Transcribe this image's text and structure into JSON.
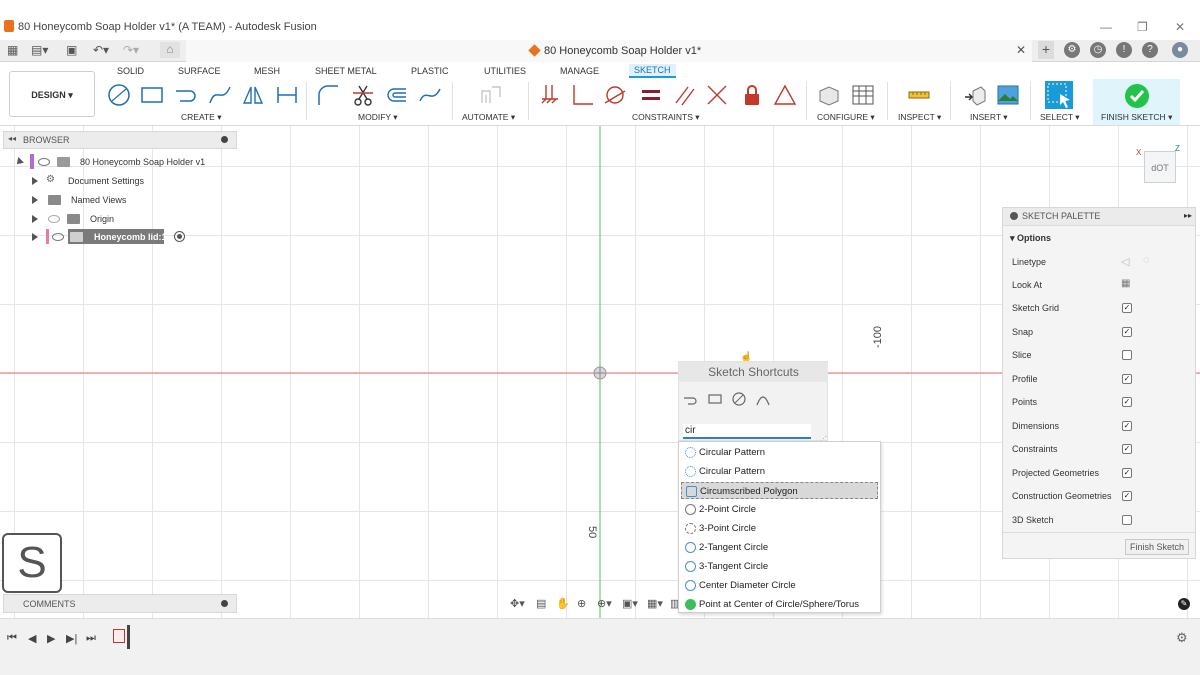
{
  "window": {
    "title": "80 Honeycomb Soap Holder v1* (A TEAM) - Autodesk Fusion",
    "controls": [
      "—",
      "❐",
      "✕"
    ]
  },
  "tabbar": {
    "doc_tab": "80 Honeycomb Soap Holder v1*",
    "close": "✕",
    "add": "+",
    "grid_icon": "grid-icon",
    "file_icon": "file-icon",
    "save_icon": "save-icon",
    "undo_icon": "undo-icon",
    "redo_icon": "redo-icon",
    "home_icon": "home-icon"
  },
  "toolbar": {
    "workspace": "DESIGN",
    "tabs": [
      "SOLID",
      "SURFACE",
      "MESH",
      "SHEET METAL",
      "PLASTIC",
      "UTILITIES",
      "MANAGE",
      "SKETCH"
    ],
    "active_tab": "SKETCH",
    "groups": [
      "CREATE",
      "MODIFY",
      "AUTOMATE",
      "CONSTRAINTS",
      "CONFIGURE",
      "INSPECT",
      "INSERT",
      "SELECT",
      "FINISH SKETCH"
    ]
  },
  "browser": {
    "title": "BROWSER",
    "items": [
      {
        "label": "80 Honeycomb Soap Holder v1"
      },
      {
        "label": "Document Settings"
      },
      {
        "label": "Named Views"
      },
      {
        "label": "Origin"
      },
      {
        "label": "Honeycomb lid:1"
      }
    ]
  },
  "comments": {
    "title": "COMMENTS"
  },
  "s_badge": "S",
  "canvas": {
    "dim_top": "-100",
    "dim_bottom": "50",
    "view_cube_label": "dOT"
  },
  "shortcuts": {
    "title": "Sketch Shortcuts",
    "search_value": "cir",
    "results": [
      "Circular Pattern",
      "Circular Pattern",
      "Circumscribed Polygon",
      "2-Point Circle",
      "3-Point Circle",
      "2-Tangent Circle",
      "3-Tangent Circle",
      "Center Diameter Circle",
      "Point at Center of Circle/Sphere/Torus"
    ],
    "selected_index": 2
  },
  "palette": {
    "title": "SKETCH PALETTE",
    "section": "Options",
    "rows": [
      {
        "label": "Linetype",
        "type": "icons"
      },
      {
        "label": "Look At",
        "type": "icon"
      },
      {
        "label": "Sketch Grid",
        "checked": true
      },
      {
        "label": "Snap",
        "checked": true
      },
      {
        "label": "Slice",
        "checked": false
      },
      {
        "label": "Profile",
        "checked": true
      },
      {
        "label": "Points",
        "checked": true
      },
      {
        "label": "Dimensions",
        "checked": true
      },
      {
        "label": "Constraints",
        "checked": true
      },
      {
        "label": "Projected Geometries",
        "checked": true
      },
      {
        "label": "Construction Geometries",
        "checked": true
      },
      {
        "label": "3D Sketch",
        "checked": false
      }
    ],
    "finish_button": "Finish Sketch"
  },
  "colors": {
    "accent": "#1a9ad6",
    "x_axis": "#e0706f",
    "y_axis": "#6fcf6f",
    "brand": "#e8731c"
  }
}
